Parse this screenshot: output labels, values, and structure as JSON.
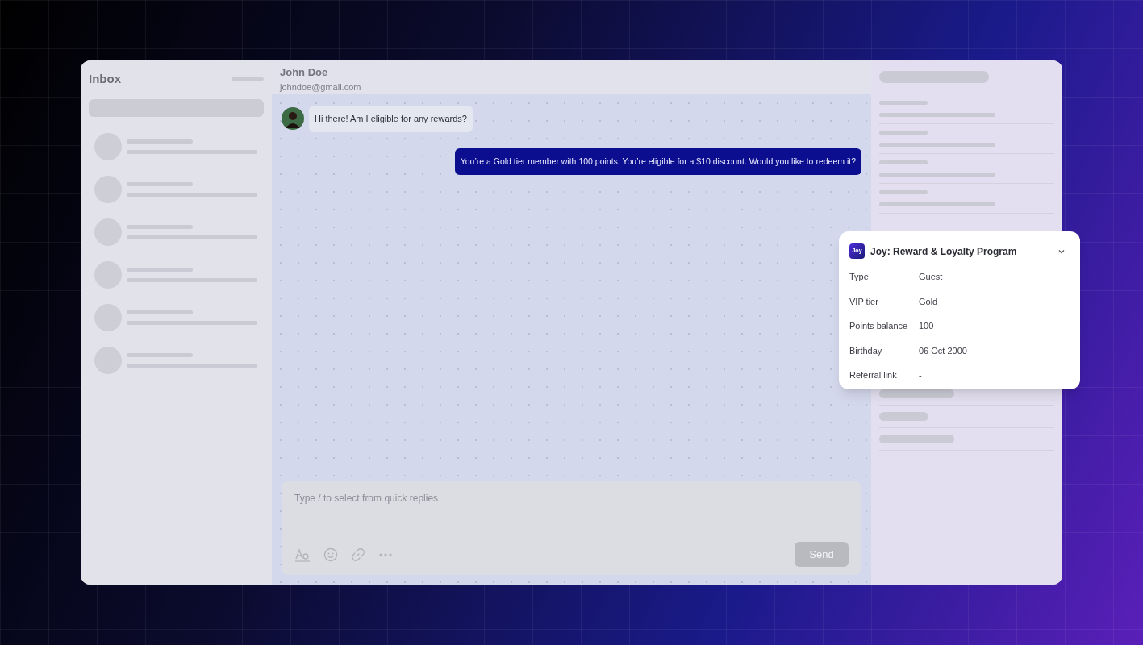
{
  "inbox": {
    "title": "Inbox"
  },
  "conversation": {
    "name": "John Doe",
    "email": "johndoe@gmail.com",
    "messages": [
      {
        "kind": "customer",
        "text": "Hi there! Am I eligible for any rewards?"
      },
      {
        "kind": "agent",
        "text": "You’re a Gold tier member with 100 points. You’re eligible for a $10 discount. Would you like to redeem it?"
      }
    ]
  },
  "composer": {
    "placeholder": "Type / to select from quick replies",
    "send_label": "Send",
    "send_disabled": true
  },
  "loyalty_card": {
    "logo": "Joy",
    "title": "Joy: Reward & Loyalty Program",
    "expanded": true,
    "fields": [
      {
        "label": "Type",
        "value": "Guest"
      },
      {
        "label": "VIP tier",
        "value": "Gold"
      },
      {
        "label": "Points balance",
        "value": "100"
      },
      {
        "label": "Birthday",
        "value": "06 Oct 2000"
      },
      {
        "label": "Referral link",
        "value": "-"
      }
    ]
  }
}
